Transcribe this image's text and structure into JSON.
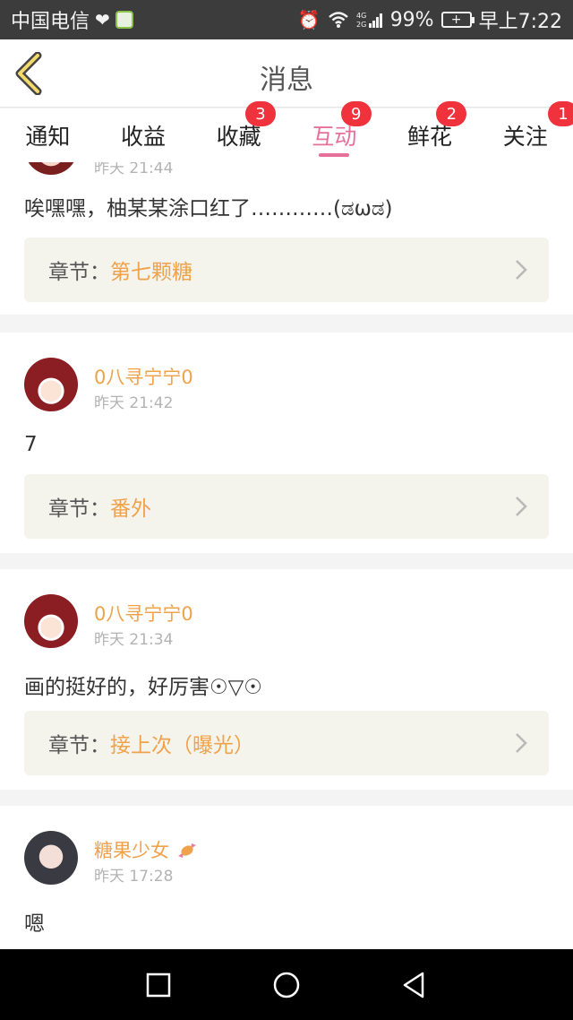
{
  "status_bar": {
    "carrier": "中国电信",
    "battery": "99%",
    "time": "早上7:22"
  },
  "header": {
    "title": "消息"
  },
  "tabs": [
    {
      "label": "通知",
      "badge": ""
    },
    {
      "label": "收益",
      "badge": ""
    },
    {
      "label": "收藏",
      "badge": "3"
    },
    {
      "label": "互动",
      "badge": "9",
      "active": true
    },
    {
      "label": "鲜花",
      "badge": "2"
    },
    {
      "label": "关注",
      "badge": "1"
    }
  ],
  "chapter_label": "章节：",
  "items": [
    {
      "time": "昨天 21:44",
      "content": "唉嘿嘿，柚某某涂口红了…………(ಡωಡ)",
      "chapter": "第七颗糖"
    },
    {
      "user": "0八寻宁宁0",
      "time": "昨天 21:42",
      "content": "7",
      "chapter": "番外"
    },
    {
      "user": "0八寻宁宁0",
      "time": "昨天 21:34",
      "content": "画的挺好的，好厉害☉▽☉",
      "chapter": "接上次（曝光）"
    },
    {
      "user": "糖果少女",
      "time": "昨天 17:28",
      "content": "嗯"
    }
  ]
}
